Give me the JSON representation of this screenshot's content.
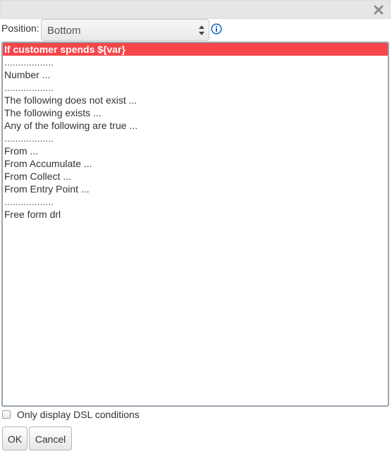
{
  "dialog": {
    "close_icon": "close-icon"
  },
  "position": {
    "label": "Position:",
    "selected": "Bottom",
    "info_icon": "info-icon"
  },
  "list": {
    "items": [
      {
        "label": "If customer spends ${var}",
        "selected": true
      },
      {
        "label": "..................",
        "separator": true
      },
      {
        "label": "Number ..."
      },
      {
        "label": "..................",
        "separator": true
      },
      {
        "label": "The following does not exist ..."
      },
      {
        "label": "The following exists ..."
      },
      {
        "label": "Any of the following are true ..."
      },
      {
        "label": "..................",
        "separator": true
      },
      {
        "label": "From ..."
      },
      {
        "label": "From Accumulate ..."
      },
      {
        "label": "From Collect ..."
      },
      {
        "label": "From Entry Point ..."
      },
      {
        "label": "..................",
        "separator": true
      },
      {
        "label": "Free form drl"
      }
    ]
  },
  "dsl_option": {
    "label": "Only display DSL conditions",
    "checked": false
  },
  "buttons": {
    "ok": "OK",
    "cancel": "Cancel"
  },
  "colors": {
    "selection": "#f5464a",
    "info_icon": "#1f6fbf"
  }
}
